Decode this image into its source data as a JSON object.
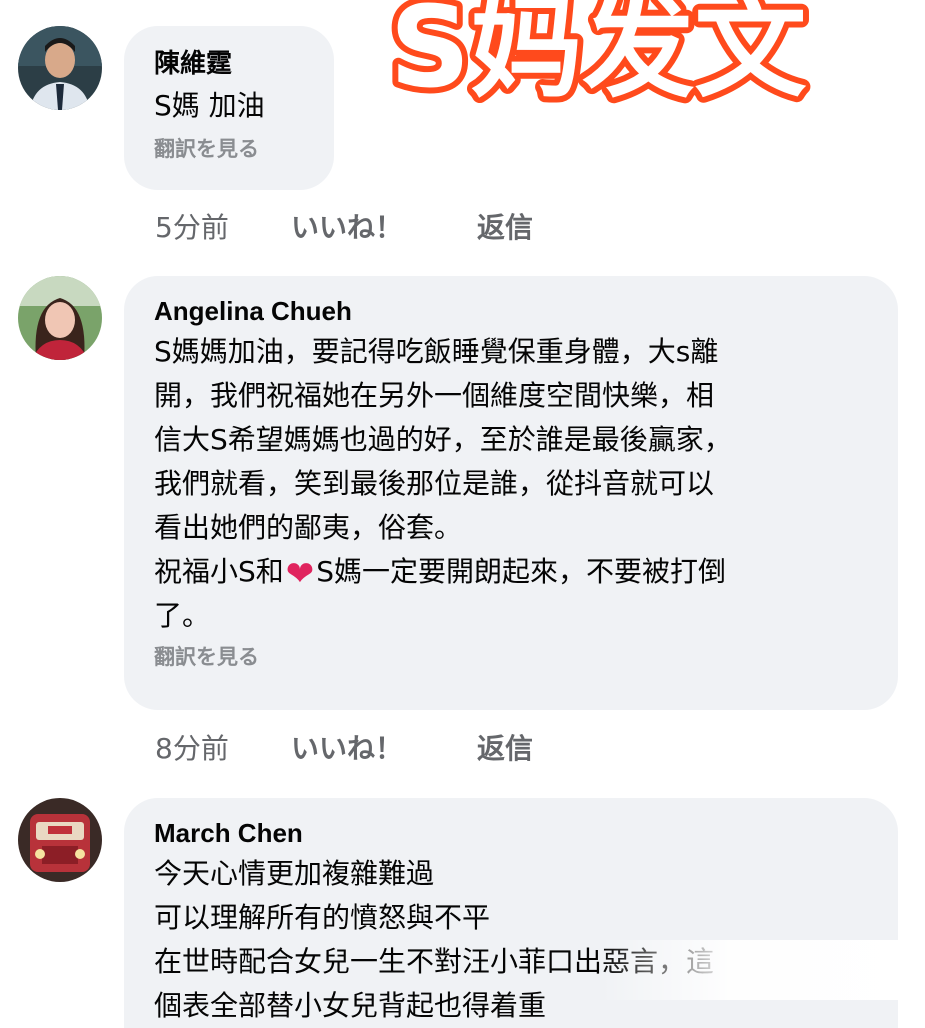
{
  "overlay_title": "S妈发文",
  "translate_label": "翻訳を見る",
  "actions": {
    "like": "いいね！",
    "reply": "返信"
  },
  "comments": [
    {
      "author": "陳維霆",
      "text": "S媽 加油",
      "time": "5分前",
      "avatar_icon": "man-portrait-avatar"
    },
    {
      "author": "Angelina Chueh",
      "text_before_heart": "S媽媽加油，要記得吃飯睡覺保重身體，大s離\n開，我們祝福她在另外一個維度空間快樂，相\n信大S希望媽媽也過的好，至於誰是最後贏家，\n我們就看，笑到最後那位是誰，從抖音就可以\n看出她們的鄙夷，俗套。\n祝福小S和",
      "heart": "❤",
      "text_after_heart": "S媽一定要開朗起來，不要被打倒\n了。",
      "time": "8分前",
      "avatar_icon": "woman-portrait-avatar"
    },
    {
      "author": "March Chen",
      "text": "今天心情更加複雜難過\n可以理解所有的憤怒與不平\n在世時配合女兒一生不對汪小菲口出惡言，這\n個表全部替小女兒背起也得着重",
      "avatar_icon": "vintage-bus-avatar"
    }
  ],
  "colors": {
    "bubble_bg": "#f0f2f5",
    "meta_text": "#65676b",
    "title_fill": "#ffffff",
    "title_stroke": "#ff4a1c"
  }
}
